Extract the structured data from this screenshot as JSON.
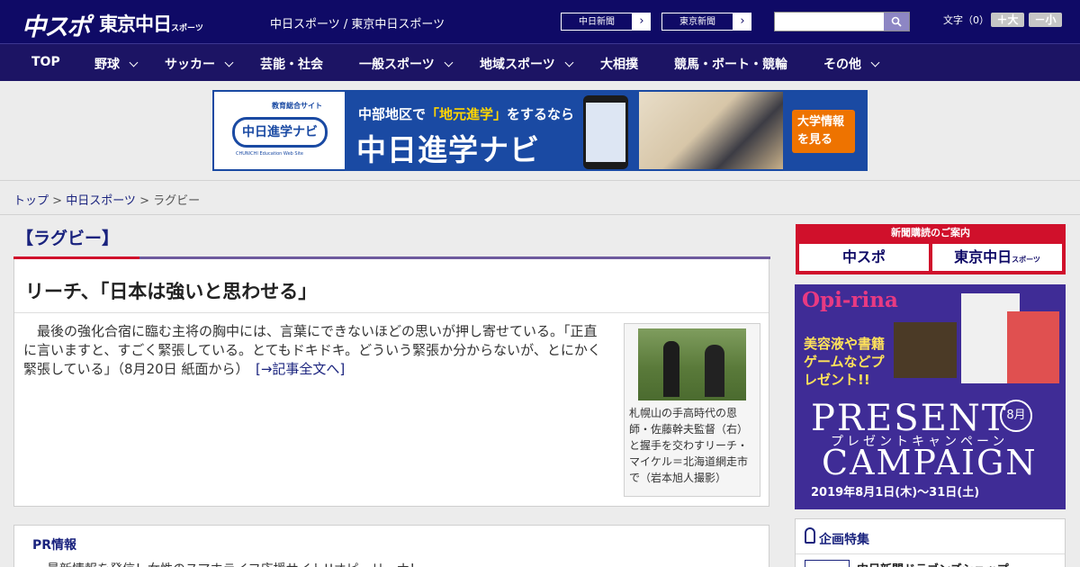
{
  "header": {
    "logo_chuspo": "中スポ",
    "logo_tokyo": "東京中日",
    "logo_tokyo_sub": "スポーツ",
    "site_links": "中日スポーツ / 東京中日スポーツ",
    "select_chunichi": "中日新聞",
    "select_tokyo": "東京新聞",
    "search_placeholder": "",
    "text_size_label": "文字（0）",
    "font_larger": "＋大",
    "font_smaller": "－小"
  },
  "nav": [
    {
      "label": "TOP",
      "has_dropdown": false
    },
    {
      "label": "野球",
      "has_dropdown": true
    },
    {
      "label": "サッカー",
      "has_dropdown": true
    },
    {
      "label": "芸能・社会",
      "has_dropdown": false
    },
    {
      "label": "一般スポーツ",
      "has_dropdown": true
    },
    {
      "label": "地域スポーツ",
      "has_dropdown": true
    },
    {
      "label": "大相撲",
      "has_dropdown": false
    },
    {
      "label": "競馬・ボート・競輪",
      "has_dropdown": false
    },
    {
      "label": "その他",
      "has_dropdown": true
    }
  ],
  "banner": {
    "logo_caption": "教育総合サイト",
    "logo_text": "中日進学ナビ",
    "logo_sub": "CHUNICHI Education Web Site",
    "tagline_pre": "中部地区で",
    "tagline_highlight": "「地元進学」",
    "tagline_post": "をするなら",
    "headline": "中日進学ナビ",
    "cta": "大学情報を見る"
  },
  "breadcrumb": {
    "top": "トップ",
    "sep": " > ",
    "section": "中日スポーツ",
    "current": "ラグビー"
  },
  "category": "【ラグビー】",
  "article": {
    "title": "リーチ、「日本は強いと思わせる」",
    "body": "最後の強化合宿に臨む主将の胸中には、言葉にできないほどの思いが押し寄せている。「正直に言いますと、すごく緊張している。とてもドキドキ。どういう緊張か分からないが、とにかく緊張している」（8月20日 紙面から）",
    "more_link": "[→記事全文へ]",
    "photo_caption": "札幌山の手高時代の恩師・佐藤幹夫監督（右）と握手を交わすリーチ・マイケル＝北海道網走市で（岩本旭人撮影）"
  },
  "pr": {
    "heading": "PR情報",
    "text": "最新情報を発信！女性のスマホライフ応援サイト!!オピ・リーナ！"
  },
  "sidebar": {
    "subscribe_heading": "新聞購読のご案内",
    "subscribe_chuspo": "中スポ",
    "subscribe_tokyo": "東京中日",
    "subscribe_tokyo_sub": "スポーツ",
    "ad": {
      "brand": "Opi-rina",
      "gift_text": "美容液や書籍ゲームなどプレゼント!!",
      "headline1": "PRESENT",
      "month": "8月",
      "kana": "プレゼントキャンペーン",
      "headline2": "CAMPAIGN",
      "dates": "2019年8月1日(木)～31日(土)"
    },
    "special_heading": "企画特集",
    "special_item": "中日新聞ドラゴンズショップ"
  },
  "colors": {
    "header_bg": "#0f0a66",
    "nav_bg": "#1c1464",
    "accent_red": "#d0102b",
    "link": "#1a237e"
  }
}
